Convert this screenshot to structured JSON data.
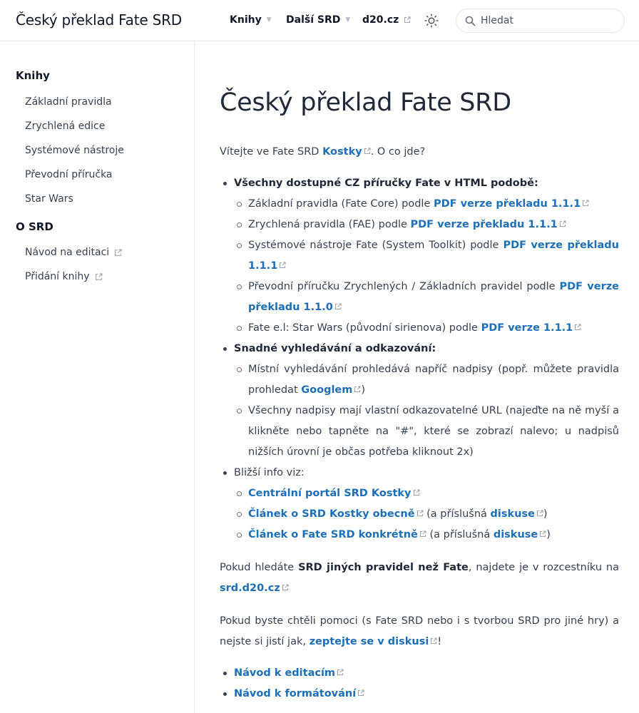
{
  "header": {
    "title": "Český překlad Fate SRD",
    "nav": [
      {
        "label": "Knihy"
      },
      {
        "label": "Další SRD"
      },
      {
        "label": "d20.cz"
      }
    ],
    "search": {
      "placeholder": "Hledat"
    }
  },
  "sidebar": {
    "section1": {
      "heading": "Knihy",
      "items": [
        "Základní pravidla",
        "Zrychlená edice",
        "Systémové nástroje",
        "Převodní příručka",
        "Star Wars"
      ]
    },
    "section2": {
      "heading": "O SRD",
      "items": [
        "Návod na editaci",
        "Přidání knihy"
      ]
    }
  },
  "main": {
    "title": "Český překlad Fate SRD",
    "intro": {
      "before": "Vítejte ve Fate SRD ",
      "link": "Kostky",
      "after": ". O co jde?"
    },
    "b1": {
      "heading": "Všechny dostupné CZ příručky Fate v HTML podobě:",
      "items": [
        {
          "text": "Základní pravidla (Fate Core) podle ",
          "link": "PDF verze překladu 1.1.1"
        },
        {
          "text": "Zrychlená pravidla (FAE) podle ",
          "link": "PDF verze překladu 1.1.1"
        },
        {
          "text": "Systémové nástroje Fate (System Toolkit) podle ",
          "link": "PDF verze překladu 1.1.1"
        },
        {
          "text": "Převodní příručku Zrychlených / Základních pravidel podle ",
          "link": "PDF verze překladu 1.1.0"
        },
        {
          "text": "Fate e.l: Star Wars (původní sirienova) podle ",
          "link": "PDF verze 1.1.1"
        }
      ]
    },
    "b2": {
      "heading": "Snadné vyhledávání a odkazování:",
      "item1": {
        "text": "Místní vyhledávání prohledává napříč nadpisy (popř. můžete pravidla prohledat ",
        "link": "Googlem",
        "after": ")"
      },
      "item2": "Všechny nadpisy mají vlastní odkazovatelné URL (najeďte na ně myší a klikněte nebo tapněte na \"#\", které se zobrazí nalevo; u nadpisů nižších úrovní je občas potřeba kliknout 2x)"
    },
    "b3": {
      "heading": "Bližší info viz:",
      "item1": {
        "link": "Centrální portál SRD Kostky"
      },
      "item2": {
        "link": "Článek o SRD Kostky obecně",
        "mid": " (a příslušná ",
        "link2": "diskuse",
        "after": ")"
      },
      "item3": {
        "link": "Článek o Fate SRD konkrétně",
        "mid": " (a příslušná ",
        "link2": "diskuse",
        "after": ")"
      }
    },
    "p2": {
      "before": "Pokud hledáte ",
      "bold": "SRD jiných pravidel než Fate",
      "mid": ", najdete je v rozcestníku na ",
      "link": "srd.d20.cz"
    },
    "p3": {
      "before": "Pokud byste chtěli pomoci (s Fate SRD nebo i s tvorbou SRD pro jiné hry) a nejste si jistí jak, ",
      "link": "zeptejte se v diskusi",
      "after": "!"
    },
    "final_links": [
      "Návod k editacím",
      "Návod k formátování"
    ]
  },
  "colors": {
    "link": "#1d6fb8",
    "text": "#374151",
    "heading": "#1f2937"
  },
  "icons": [
    "external-link-icon",
    "sun-icon",
    "search-icon",
    "chevron-down-icon"
  ]
}
